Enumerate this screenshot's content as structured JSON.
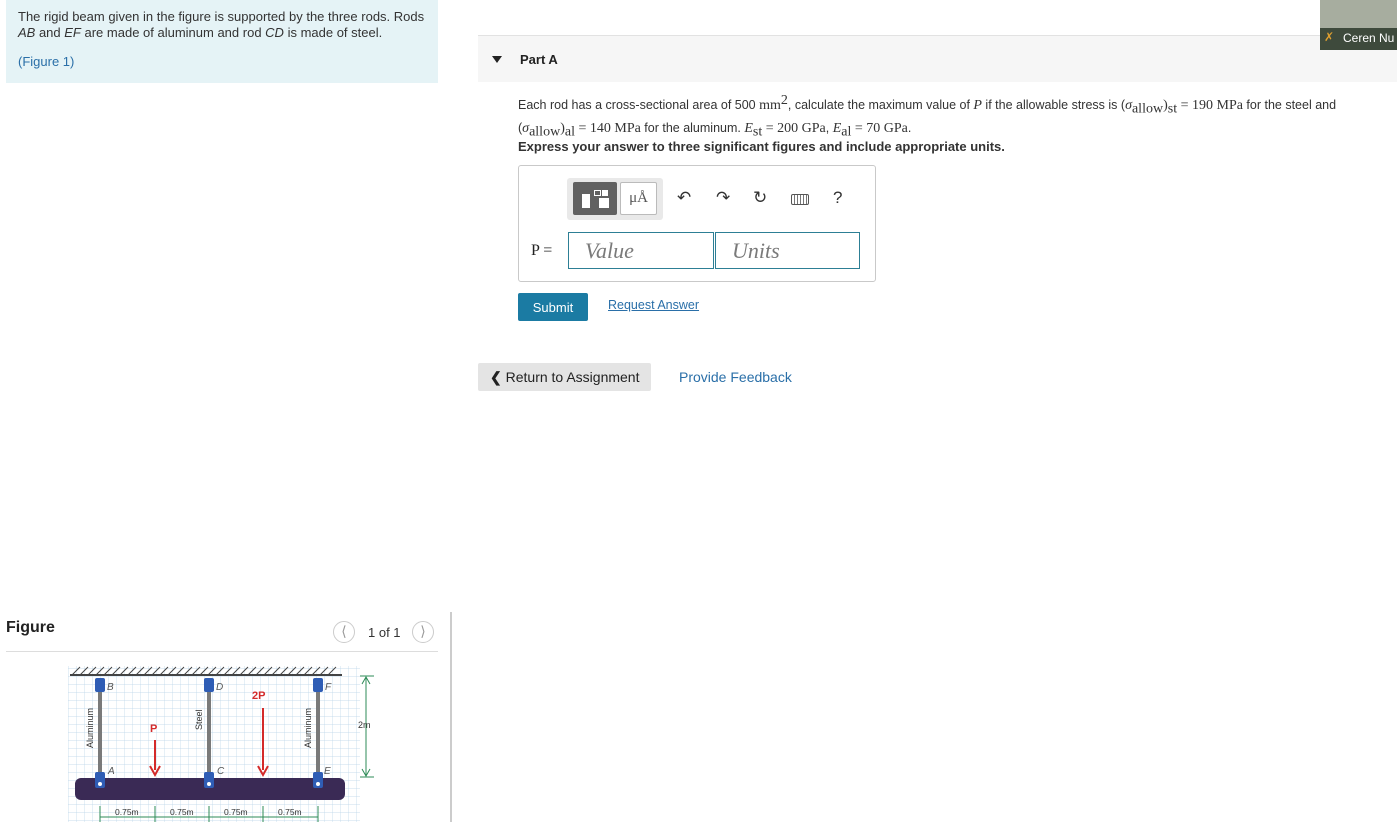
{
  "problem": {
    "statement_pre": "The rigid beam given in the figure is supported by the three rods. Rods ",
    "rod_ab": "AB",
    "and": " and ",
    "rod_ef": "EF",
    "statement_mid": " are made of aluminum and rod ",
    "rod_cd": "CD",
    "statement_post": " is made of steel.",
    "figure_link": "(Figure 1)"
  },
  "figure_panel": {
    "title": "Figure",
    "counter": "1 of 1",
    "prev_icon": "chevron-left-icon",
    "next_icon": "chevron-right-icon",
    "diagram": {
      "labels": {
        "B": "B",
        "D": "D",
        "F": "F",
        "A": "A",
        "C": "C",
        "E": "E",
        "P": "P",
        "P2": "2P",
        "height": "2m",
        "rod_left": "Aluminum",
        "rod_mid": "Steel",
        "rod_right": "Aluminum"
      },
      "spans": [
        "0.75m",
        "0.75m",
        "0.75m",
        "0.75m"
      ]
    }
  },
  "webcam": {
    "name": "Ceren Nu",
    "mic_icon": "mic-muted-icon"
  },
  "part": {
    "title": "Part A",
    "toggle_icon": "caret-down-icon"
  },
  "question": {
    "t1": "Each rod has a cross-sectional area of 500 ",
    "mm": "mm",
    "sq": "2",
    "t2": ", calculate the maximum value of ",
    "P": "P",
    "t3": " if the allowable stress is (",
    "sigma": "σ",
    "allow": "allow",
    "st_sub": "st",
    "eq190": " = 190 MPa",
    "t4": " for the steel and (",
    "al_sub": "al",
    "eq140": " = 140 MPa",
    "t5": " for the aluminum. ",
    "E": "E",
    "eqE1": " = 200 GPa",
    "comma": ", ",
    "eqE2": " = 70 GPa",
    "period": "."
  },
  "instructions": "Express your answer to three significant figures and include appropriate units.",
  "answer": {
    "toolbar": {
      "units_button": "μÅ",
      "template_icon": "template-icon",
      "undo_icon": "undo-icon",
      "redo_icon": "redo-icon",
      "reset_icon": "reset-icon",
      "keyboard_icon": "keyboard-icon",
      "help": "?"
    },
    "label": "P =",
    "value_placeholder": "Value",
    "units_placeholder": "Units"
  },
  "buttons": {
    "submit": "Submit",
    "request_answer": "Request Answer",
    "return": "Return to Assignment",
    "return_icon": "chevron-left-icon",
    "feedback": "Provide Feedback"
  },
  "colors": {
    "problem_bg": "#e5f3f6",
    "link": "#2a6fa8",
    "submit": "#1b7ba3",
    "input_border": "#2d7f95",
    "beam": "#3a2a55",
    "pin": "#2f5db5",
    "load_arrow": "#d42a2a",
    "dimension": "#2e8b57"
  }
}
